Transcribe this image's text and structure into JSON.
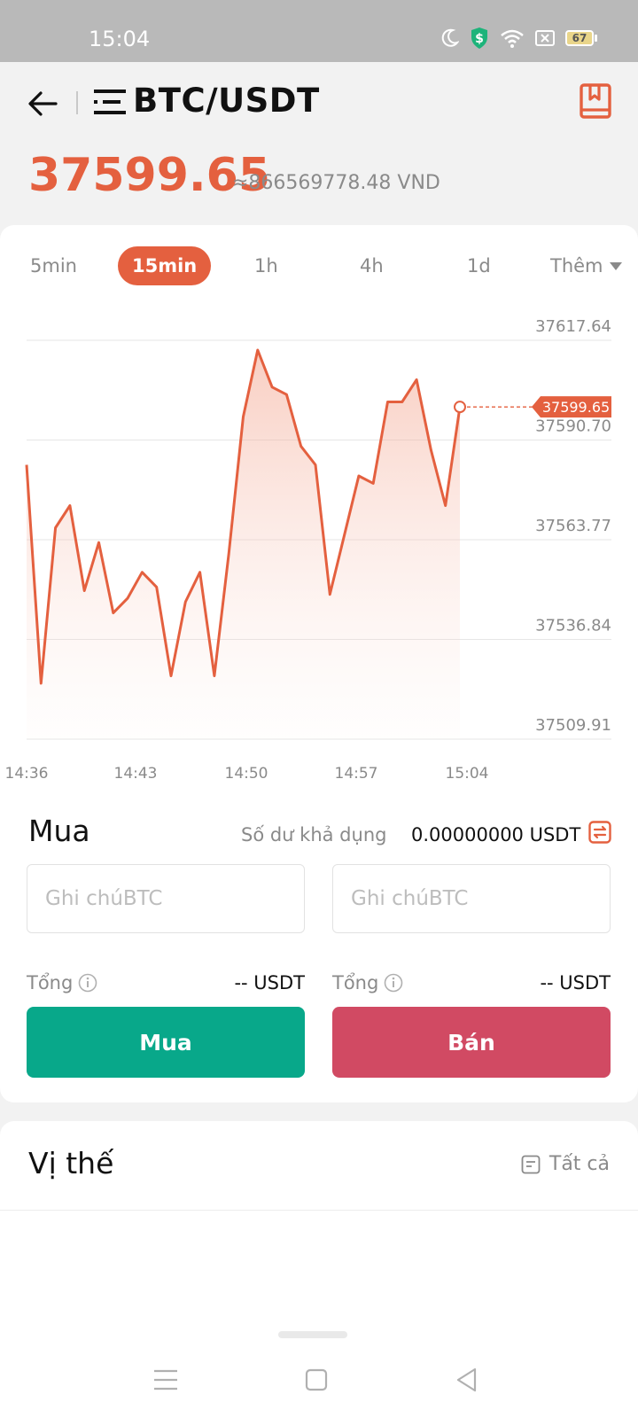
{
  "status_bar": {
    "time": "15:04",
    "battery": "67",
    "icons": [
      "moon-icon",
      "shield-dollar-icon",
      "wifi-icon",
      "close-box-icon",
      "battery-icon"
    ]
  },
  "header": {
    "pair": "BTC/USDT",
    "price": "37599.65",
    "price_vnd": "≈866569778.48 VND",
    "accent_color": "#e4603f"
  },
  "timeframes": {
    "items": [
      "5min",
      "15min",
      "1h",
      "4h",
      "1d"
    ],
    "active": "15min",
    "more_label": "Thêm"
  },
  "chart_data": {
    "type": "area",
    "x_tick_labels": [
      "14:36",
      "14:43",
      "14:50",
      "14:57",
      "15:04"
    ],
    "y_tick_labels": [
      "37617.64",
      "37590.70",
      "37563.77",
      "37536.84",
      "37509.91"
    ],
    "ylim": [
      37509.91,
      37617.64
    ],
    "grid": true,
    "current_value_label": "37599.65",
    "points": [
      [
        0,
        37584
      ],
      [
        1,
        37525
      ],
      [
        2,
        37567
      ],
      [
        3,
        37573
      ],
      [
        4,
        37550
      ],
      [
        5,
        37563
      ],
      [
        6,
        37544
      ],
      [
        7,
        37548
      ],
      [
        8,
        37555
      ],
      [
        9,
        37551
      ],
      [
        10,
        37527
      ],
      [
        11,
        37547
      ],
      [
        12,
        37555
      ],
      [
        13,
        37527
      ],
      [
        14,
        37560
      ],
      [
        15,
        37597
      ],
      [
        16,
        37615
      ],
      [
        17,
        37605
      ],
      [
        18,
        37603
      ],
      [
        19,
        37589
      ],
      [
        20,
        37584
      ],
      [
        21,
        37549
      ],
      [
        22,
        37565
      ],
      [
        23,
        37581
      ],
      [
        24,
        37579
      ],
      [
        25,
        37601
      ],
      [
        26,
        37601
      ],
      [
        27,
        37607
      ],
      [
        28,
        37588
      ],
      [
        29,
        37573
      ],
      [
        30,
        37599.65
      ]
    ],
    "line_color": "#e4603f"
  },
  "trade": {
    "title": "Mua",
    "balance_label": "Số dư khả dụng",
    "balance_value": "0.00000000 USDT",
    "buy_placeholder": "Ghi chúBTC",
    "sell_placeholder": "Ghi chúBTC",
    "total_label": "Tổng",
    "total_value": "-- USDT",
    "buy_button": "Mua",
    "sell_button": "Bán",
    "buy_color": "#08a88a",
    "sell_color": "#d14a63"
  },
  "positions": {
    "title": "Vị thế",
    "all_label": "Tất cả"
  },
  "nav_bar": {
    "icons": [
      "menu-icon",
      "home-square-icon",
      "back-triangle-icon"
    ]
  }
}
